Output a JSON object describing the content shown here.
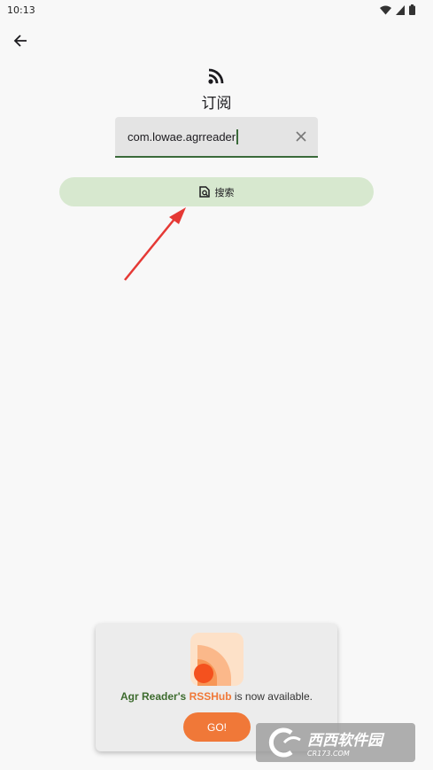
{
  "status_bar": {
    "time": "10:13"
  },
  "header": {
    "title": "订阅"
  },
  "search": {
    "input_value": "com.lowae.agrreader",
    "button_label": "搜索"
  },
  "promo": {
    "app_name": "Agr Reader's",
    "feature": "RSSHub",
    "message": "is now available.",
    "go_label": "GO!"
  },
  "watermark": {
    "brand": "西西软件园",
    "site": "CR173.COM"
  },
  "colors": {
    "accent_green": "#3a6a3a",
    "button_bg": "#d7e8cf",
    "orange": "#f07838",
    "arrow_red": "#e53935"
  },
  "icons": [
    "arrow-back-icon",
    "rss-icon",
    "clear-icon",
    "search-doc-icon",
    "wifi-icon",
    "signal-icon",
    "battery-icon"
  ]
}
